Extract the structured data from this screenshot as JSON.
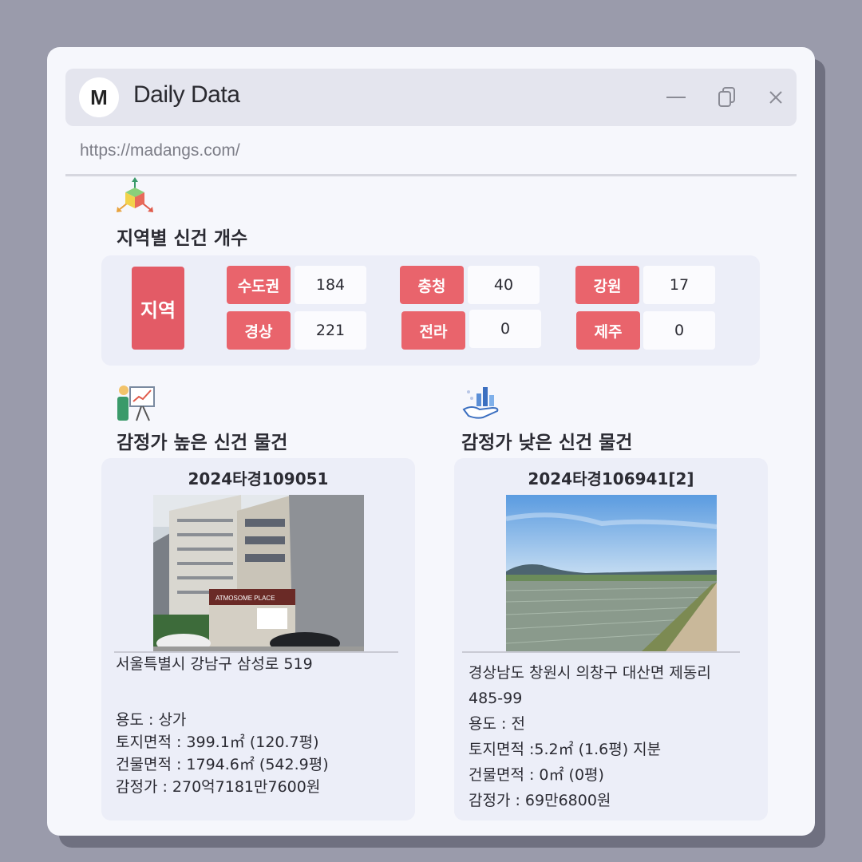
{
  "window": {
    "logo_letter": "M",
    "title": "Daily Data",
    "url": "https://madangs.com/"
  },
  "region_section": {
    "icon": "cube-axes-icon",
    "title": "지역별 신건 개수",
    "main_label": "지역",
    "regions": [
      {
        "name": "수도권",
        "count": "184"
      },
      {
        "name": "충청",
        "count": "40"
      },
      {
        "name": "강원",
        "count": "17"
      },
      {
        "name": "경상",
        "count": "221"
      },
      {
        "name": "전라",
        "count": "0"
      },
      {
        "name": "제주",
        "count": "0"
      }
    ]
  },
  "high_section": {
    "icon": "presentation-chart-icon",
    "title": "감정가 높은 신건 물건",
    "case_no": "2024타경109051",
    "address": "서울특별시 강남구 삼성로 519",
    "address_cont": "",
    "usage": "용도 : 상가",
    "land_area": "토지면적 : 399.1㎡ (120.7평)",
    "building_area": "건물면적 : 1794.6㎡ (542.9평)",
    "appraisal": "감정가 : 270억7181만7600원",
    "photo_sign": "ATMOSOME PLACE"
  },
  "low_section": {
    "icon": "hand-bar-chart-icon",
    "title": "감정가 낮은 신건 물건",
    "case_no": "2024타경106941[2]",
    "address": "경상남도 창원시 의창구 대산면 제동리",
    "address_cont": "485-99",
    "usage": "용도 : 전",
    "land_area": "토지면적 :5.2㎡ (1.6평) 지분",
    "building_area": "건물면적 : 0㎡ (0평)",
    "appraisal": "감정가 : 69만6800원"
  },
  "colors": {
    "background": "#9a9bab",
    "window": "#f6f7fc",
    "panel": "#eceef8",
    "accent_red": "#e9646c",
    "accent_red_dark": "#e35b66"
  }
}
